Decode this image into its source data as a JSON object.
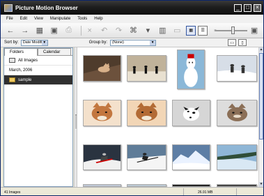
{
  "window": {
    "title": "Picture Motion Browser",
    "minimize_label": "_",
    "maximize_label": "□",
    "close_label": "×"
  },
  "menu": {
    "items": [
      "File",
      "Edit",
      "View",
      "Manipulate",
      "Tools",
      "Help"
    ]
  },
  "toolbar": {
    "icons": [
      "back-arrow-icon",
      "forward-arrow-icon",
      "import-icon",
      "export-icon",
      "print-icon",
      "delete-icon",
      "rotate-left-icon",
      "rotate-right-icon",
      "palette-icon",
      "tag-icon",
      "filter-icon",
      "display-icon",
      "thumbnail-view-icon",
      "list-view-icon",
      "small-view-icon",
      "zoom-slider",
      "large-view-icon"
    ]
  },
  "filters": {
    "sort_label": "Sort by:",
    "sort_value": "Date Modified",
    "group_label": "Group by:",
    "group_value": "(None)"
  },
  "left_panel": {
    "tabs": [
      "Folders",
      "Calendar"
    ],
    "items": [
      {
        "label": "All Images",
        "icon": "all-images-icon"
      },
      {
        "label": "March, 2006",
        "icon": ""
      },
      {
        "label": "sample",
        "icon": "folder-icon",
        "selected": true
      }
    ]
  },
  "images": [
    {
      "name": "cat-on-chair-thumbnail",
      "subject": "cat",
      "colors": [
        "#4f3c2c",
        "#d8b18a"
      ]
    },
    {
      "name": "people-sunset-thumbnail",
      "subject": "people",
      "colors": [
        "#111",
        "#c0b29a"
      ]
    },
    {
      "name": "snowman-thumbnail",
      "subject": "snowman",
      "colors": [
        "#8bb8d8",
        "#fff"
      ]
    },
    {
      "name": "ski-couple-thumbnail",
      "subject": "skiers",
      "colors": [
        "#d7dee7",
        "#333"
      ]
    },
    {
      "name": "shiba-dog-thumbnail",
      "subject": "dog",
      "colors": [
        "#c3773f",
        "#f4e1cc"
      ]
    },
    {
      "name": "corgi-dog-thumbnail",
      "subject": "dog",
      "colors": [
        "#b36b35",
        "#f2d6b6"
      ]
    },
    {
      "name": "dalmatian-thumbnail",
      "subject": "dalmatian",
      "colors": [
        "#d6d6d6",
        "#111"
      ]
    },
    {
      "name": "kitten-thumbnail",
      "subject": "kitten",
      "colors": [
        "#8b6f57",
        "#ddd"
      ]
    },
    {
      "name": "snowboard-thumbnail",
      "subject": "snowboard",
      "colors": [
        "#2a3340",
        "#f0f0f0"
      ]
    },
    {
      "name": "ski-jump-thumbnail",
      "subject": "skier",
      "colors": [
        "#5f7c98",
        "#f5f5f5"
      ]
    },
    {
      "name": "mountain-thumbnail",
      "subject": "mountain",
      "colors": [
        "#5d7ea5",
        "#eaf2ff"
      ]
    },
    {
      "name": "snow-field-thumbnail",
      "subject": "snow-slope",
      "colors": [
        "#d9e8f4",
        "#2f4d38"
      ]
    }
  ],
  "status": {
    "count": "41 Images",
    "size": "26.91 MB"
  }
}
